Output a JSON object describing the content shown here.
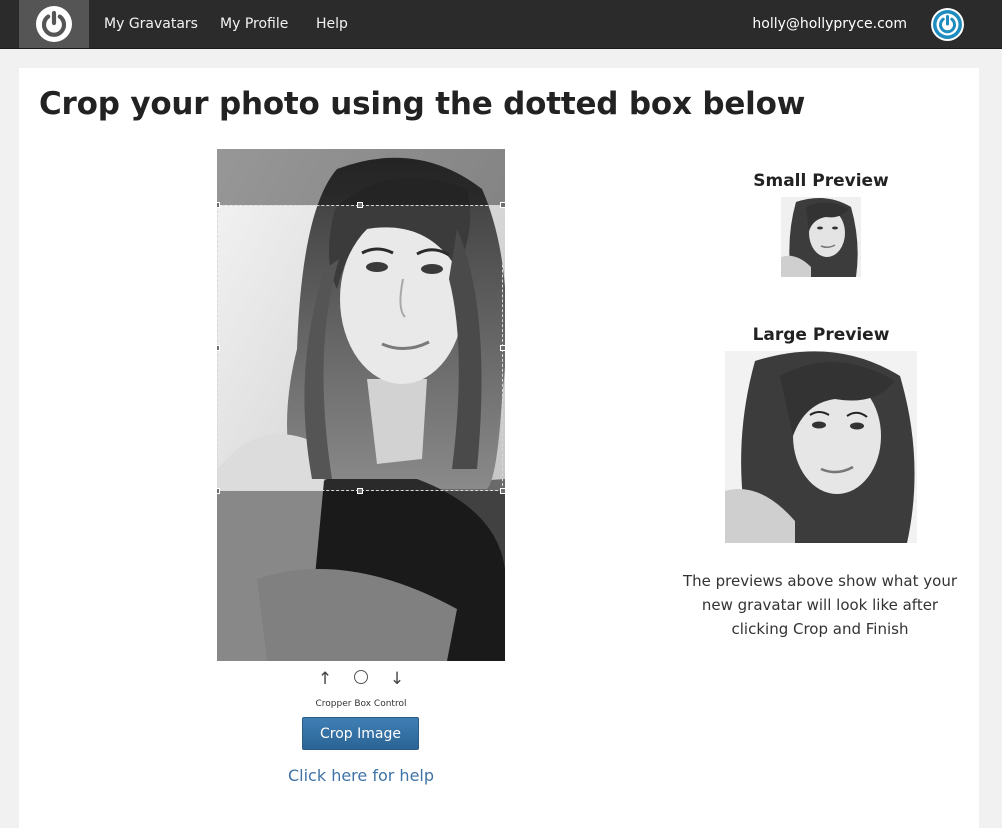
{
  "topbar": {
    "logo_icon": "gravatar-power-icon",
    "nav": [
      {
        "label": "My Gravatars"
      },
      {
        "label": "My Profile"
      },
      {
        "label": "Help"
      }
    ],
    "user_email": "holly@hollypryce.com",
    "avatar_icon": "gravatar-power-icon"
  },
  "main": {
    "title": "Crop your photo using the dotted box below",
    "cropper": {
      "controls": [
        {
          "icon": "arrow-up-icon",
          "glyph": "↑"
        },
        {
          "icon": "circle-icon"
        },
        {
          "icon": "arrow-down-icon",
          "glyph": "↓"
        }
      ],
      "controls_label": "Cropper Box Control",
      "crop_button": "Crop Image",
      "help_link": "Click here for help"
    },
    "previews": {
      "small_heading": "Small Preview",
      "large_heading": "Large Preview",
      "note": "The previews above show what your new gravatar will look like after clicking Crop and Finish"
    }
  },
  "colors": {
    "topbar_bg": "#2b2b2b",
    "button_blue": "#2b6496",
    "link_blue": "#3f73a6",
    "avatar_blue": "#1e8cbe"
  }
}
